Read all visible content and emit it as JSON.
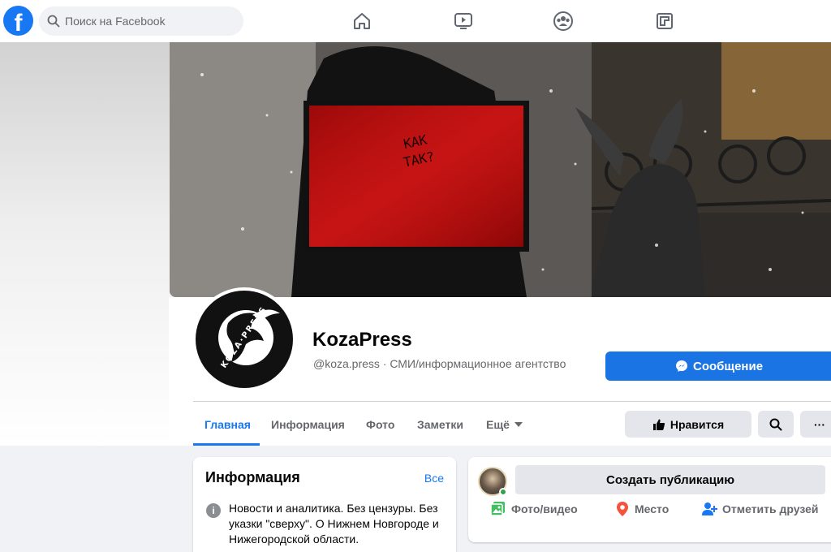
{
  "topbar": {
    "logo": "f",
    "search_placeholder": "Поиск на Facebook",
    "nav_icons": [
      "home-icon",
      "watch-icon",
      "groups-icon",
      "gaming-icon"
    ]
  },
  "cover": {
    "sign_text_line1": "КАК",
    "sign_text_line2": "ТАК?"
  },
  "profile": {
    "name": "KozaPress",
    "subtitle": "@koza.press · СМИ/информационное агентство",
    "avatar_text": "KOZA·PRESS",
    "message_button": "Сообщение"
  },
  "tabs": [
    {
      "label": "Главная",
      "active": true
    },
    {
      "label": "Информация",
      "active": false
    },
    {
      "label": "Фото",
      "active": false
    },
    {
      "label": "Заметки",
      "active": false
    },
    {
      "label": "Ещё",
      "active": false
    }
  ],
  "actions": {
    "like_label": "Нравится",
    "more_label": "···"
  },
  "info_card": {
    "title": "Информация",
    "all_link": "Все",
    "description": "Новости и аналитика. Без цензуры. Без указки \"сверху\". О Нижнем Новгороде и Нижегородской области."
  },
  "composer": {
    "create_label": "Создать публикацию",
    "photo_label": "Фото/видео",
    "place_label": "Место",
    "tag_label": "Отметить друзей"
  },
  "colors": {
    "brand": "#1877f2",
    "button_blue": "#1b74e4",
    "online": "#31a24c"
  }
}
